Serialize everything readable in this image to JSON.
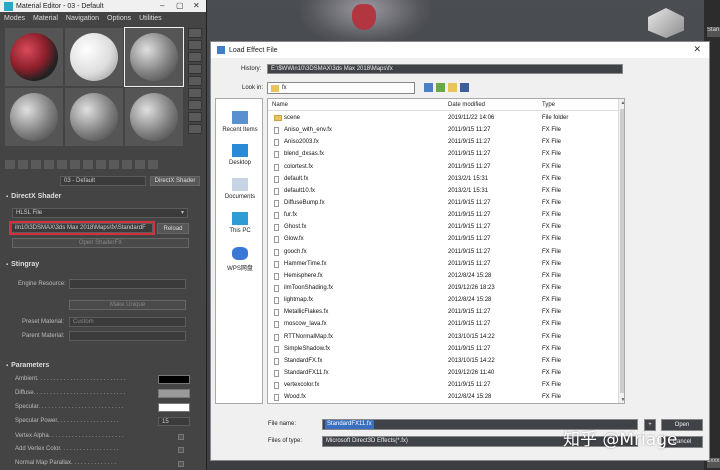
{
  "material_editor": {
    "title": "Material Editor - 03 - Default",
    "menu": [
      "Modes",
      "Material",
      "Navigation",
      "Options",
      "Utilities"
    ],
    "material_name": "03 - Default",
    "material_type_button": "DirectX Shader",
    "directx_shader": {
      "header": "DirectX Shader",
      "mode_value": "HLSL File",
      "path_value": "iln10\\3DSMAX\\3ds Max 2018\\Maps\\fx\\StandardF",
      "reload_label": "Reload",
      "open_shaderfx_label": "Open ShaderFX"
    },
    "stingray": {
      "header": "Stingray",
      "engine_resource_label": "Engine Resource:",
      "make_unique_label": "Make Unique",
      "preset_material_label": "Preset Material:",
      "preset_material_value": "Custom",
      "parent_material_label": "Parent Material:"
    },
    "parameters": {
      "header": "Parameters",
      "ambient_label": "Ambient. . . . . . . . . . . . . . . . . . . . . . . . . . .",
      "diffuse_label": "Diffuse. . . . . . . . . . . . . . . . . . . . . . . . . . . .",
      "specular_label": "Specular. . . . . . . . . . . . . . . . . . . . . . . . . .",
      "specular_power_label": "Specular Power. . . . . . . . . . . . . . . . . . .",
      "specular_power_value": "15",
      "vertex_alpha_label": "Vertex Alpha. . . . . . . . . . . . . . . . . . . . . . .",
      "add_vertex_color_label": "Add Vertex Color. . . . . . . . . . . . . . . . . .",
      "normal_map_parallax_label": "Normal Map Parallax. . . . . . . . . . . . . ."
    },
    "colors": {
      "ambient": "#000000",
      "diffuse": "#9a9a9a",
      "specular": "#ffffff"
    }
  },
  "dialog": {
    "title": "Load Effect File",
    "history_label": "History:",
    "history_value": "E:\\$WWin10\\3DSMAX\\3ds Max 2018\\Maps\\fx",
    "look_in_label": "Look in:",
    "look_in_value": "fx",
    "places": [
      "Recent Items",
      "Desktop",
      "Documents",
      "This PC",
      "WPS网盘"
    ],
    "columns": [
      "Name",
      "Date modified",
      "Type"
    ],
    "files": [
      {
        "name": "scene",
        "date": "2019/11/22 14:06",
        "type": "File folder",
        "folder": true
      },
      {
        "name": "Aniso_with_env.fx",
        "date": "2011/9/15 11:27",
        "type": "FX File"
      },
      {
        "name": "Aniso2003.fx",
        "date": "2011/9/15 11:27",
        "type": "FX File"
      },
      {
        "name": "blend_dxsas.fx",
        "date": "2011/9/15 11:27",
        "type": "FX File"
      },
      {
        "name": "colortest.fx",
        "date": "2011/9/15 11:27",
        "type": "FX File"
      },
      {
        "name": "default.fx",
        "date": "2013/2/1 15:31",
        "type": "FX File"
      },
      {
        "name": "default10.fx",
        "date": "2013/2/1 15:31",
        "type": "FX File"
      },
      {
        "name": "DiffuseBump.fx",
        "date": "2011/9/15 11:27",
        "type": "FX File"
      },
      {
        "name": "fur.fx",
        "date": "2011/9/15 11:27",
        "type": "FX File"
      },
      {
        "name": "Ghost.fx",
        "date": "2011/9/15 11:27",
        "type": "FX File"
      },
      {
        "name": "Glow.fx",
        "date": "2011/9/15 11:27",
        "type": "FX File"
      },
      {
        "name": "gooch.fx",
        "date": "2011/9/15 11:27",
        "type": "FX File"
      },
      {
        "name": "HammerTime.fx",
        "date": "2011/9/15 11:27",
        "type": "FX File"
      },
      {
        "name": "Hemisphere.fx",
        "date": "2012/8/24 15:28",
        "type": "FX File"
      },
      {
        "name": "ilmToonShading.fx",
        "date": "2019/12/26 18:23",
        "type": "FX File"
      },
      {
        "name": "lightmap.fx",
        "date": "2012/8/24 15:28",
        "type": "FX File"
      },
      {
        "name": "MetallicFlakes.fx",
        "date": "2011/9/15 11:27",
        "type": "FX File"
      },
      {
        "name": "moscow_lava.fx",
        "date": "2011/9/15 11:27",
        "type": "FX File"
      },
      {
        "name": "RTTNormalMap.fx",
        "date": "2013/10/15 14:22",
        "type": "FX File"
      },
      {
        "name": "SimpleShadow.fx",
        "date": "2011/9/15 11:27",
        "type": "FX File"
      },
      {
        "name": "StandardFX.fx",
        "date": "2013/10/15 14:22",
        "type": "FX File"
      },
      {
        "name": "StandardFX11.fx",
        "date": "2019/12/26 11:40",
        "type": "FX File"
      },
      {
        "name": "vertexcolor.fx",
        "date": "2011/9/15 11:27",
        "type": "FX File"
      },
      {
        "name": "Wood.fx",
        "date": "2012/8/24 15:28",
        "type": "FX File"
      }
    ],
    "file_name_label": "File name:",
    "file_name_value": "StandardFX11.fx",
    "files_of_type_label": "Files of type:",
    "files_of_type_value": "Microsoft Direct3D Effects(*.fx)",
    "plus_label": "+",
    "open_label": "Open",
    "cancel_label": "Cancel"
  },
  "right_strip": {
    "item1": "Stan",
    "item2": "1xxx"
  },
  "watermark": "知乎 @Mriage"
}
